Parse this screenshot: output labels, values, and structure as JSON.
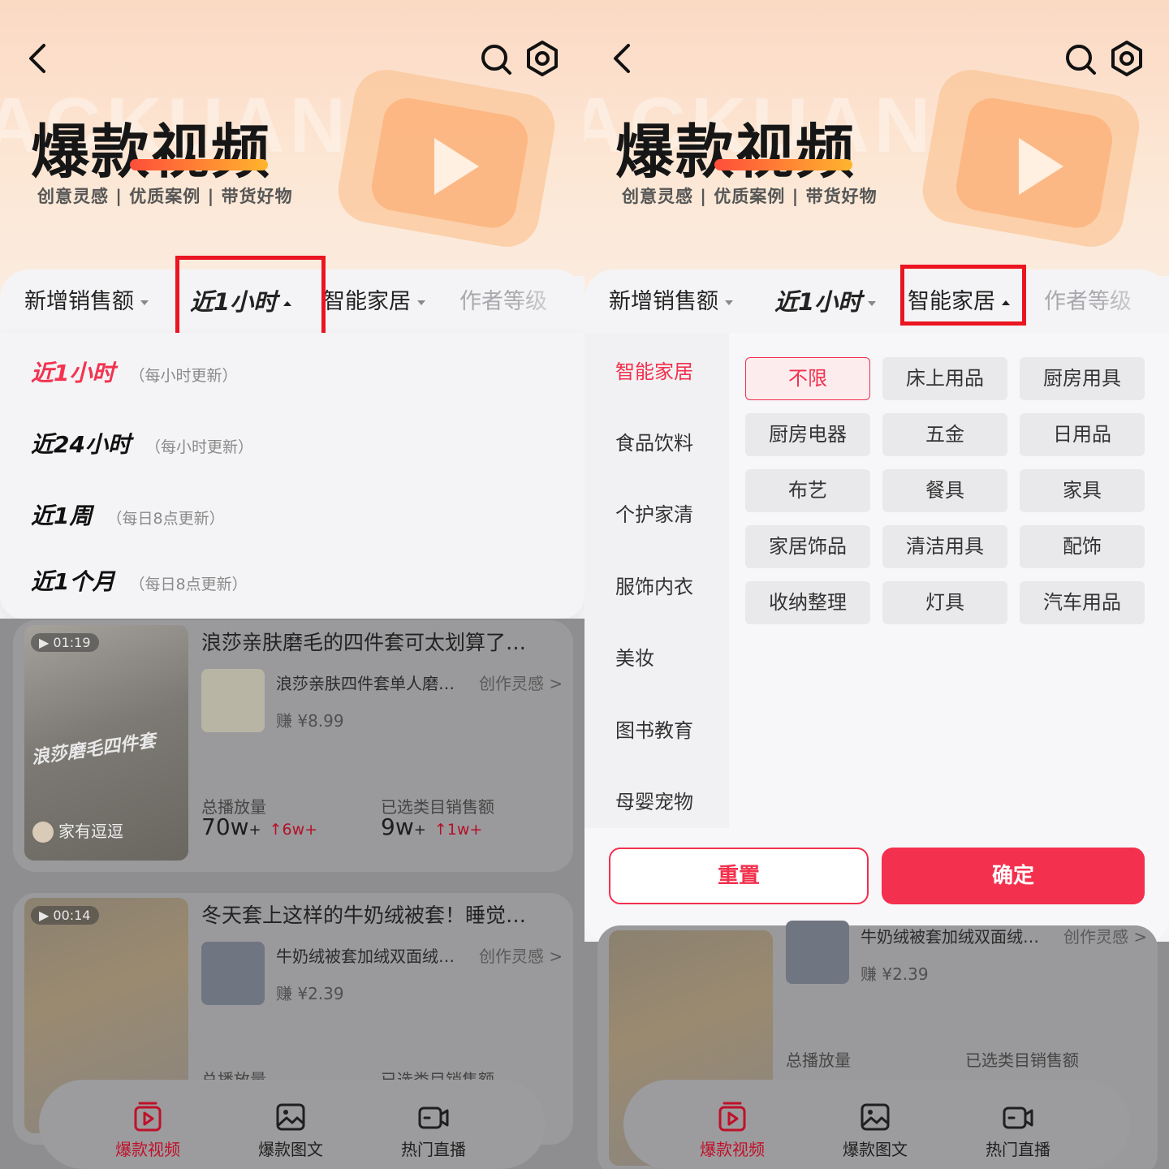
{
  "hero": {
    "title": "爆款视频",
    "subtitle": "创意灵感 | 优质案例 | 带货好物",
    "watermark": "ACKUAN"
  },
  "filters": {
    "sales": "新增销售额",
    "time": "近1小时",
    "category": "智能家居",
    "author": "作者等级"
  },
  "time_options": [
    {
      "label": "近1小时",
      "note": "（每小时更新）"
    },
    {
      "label": "近24小时",
      "note": "（每小时更新）"
    },
    {
      "label": "近1周",
      "note": "（每日8点更新）"
    },
    {
      "label": "近1个月",
      "note": "（每日8点更新）"
    }
  ],
  "cards": [
    {
      "duration": "01:19",
      "title": "浪莎亲肤磨毛的四件套可太划算了…",
      "thumb_text": "浪莎磨毛四件套",
      "author": "家有逗逗",
      "product": "浪莎亲肤四件套单人磨…",
      "link": "创作灵感 >",
      "earn": "赚 ¥8.99",
      "play_label": "总播放量",
      "play_value": "70w",
      "play_plus": "+",
      "play_delta": "↑6w+",
      "sales_label": "已选类目销售额",
      "sales_value": "9w",
      "sales_plus": "+",
      "sales_delta": "↑1w+"
    },
    {
      "duration": "00:14",
      "title": "冬天套上这样的牛奶绒被套！睡觉…",
      "product": "牛奶绒被套加绒双面绒…",
      "link": "创作灵感 >",
      "earn": "赚 ¥2.39",
      "play_label": "总播放量",
      "sales_label": "已选类目销售额"
    }
  ],
  "categories": [
    "智能家居",
    "食品饮料",
    "个护家清",
    "服饰内衣",
    "美妆",
    "图书教育",
    "母婴宠物"
  ],
  "subcategories": [
    "不限",
    "床上用品",
    "厨房用具",
    "厨房电器",
    "五金",
    "日用品",
    "布艺",
    "餐具",
    "家具",
    "家居饰品",
    "清洁用具",
    "配饰",
    "收纳整理",
    "灯具",
    "汽车用品"
  ],
  "actions": {
    "reset": "重置",
    "confirm": "确定"
  },
  "nav": [
    {
      "label": "爆款视频",
      "icon": "video-icon"
    },
    {
      "label": "爆款图文",
      "icon": "image-icon"
    },
    {
      "label": "热门直播",
      "icon": "live-icon"
    }
  ],
  "colors": {
    "accent": "#f3304d",
    "highlight": "#ea1521"
  }
}
